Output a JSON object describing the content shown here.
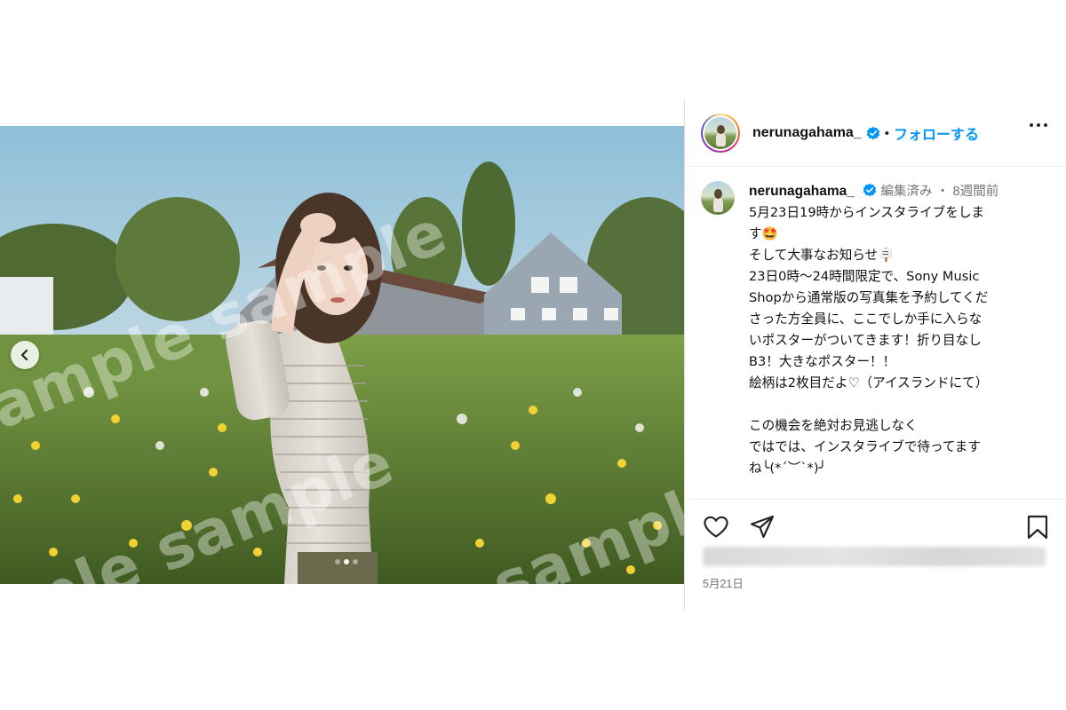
{
  "post": {
    "watermark_text": "sample sample",
    "carousel": {
      "total_slides": 3,
      "active_slide": 2
    }
  },
  "header": {
    "username": "nerunagahama_",
    "separator": "•",
    "follow_label": "フォローする"
  },
  "comment": {
    "username": "nerunagahama_",
    "edited_label": "編集済み",
    "separator": "・",
    "time_ago": "8週間前",
    "caption": "5月23日19時からインスタライブをしま\nす🤩\nそして大事なお知らせ🪧\n23日0時〜24時間限定で、Sony Music\nShopから通常版の写真集を予約してくだ\nさった方全員に、ここでしか手に入らな\nいポスターがついてきます！折り目なし\nB3！大きなポスター！！\n絵柄は2枚目だよ♡（アイスランドにて）\n\nこの機会を絶対お見逃しなく\nではでは、インスタライブで待ってます\nね╰(*´︶`*)╯"
  },
  "footer": {
    "post_date": "5月21日"
  },
  "icons": [
    "chevron-left-icon",
    "verified-badge-icon",
    "more-options-icon",
    "heart-icon",
    "share-icon",
    "bookmark-icon"
  ],
  "colors": {
    "follow_blue": "#0095f6",
    "verified_blue": "#0095f6",
    "meta_gray": "#737373"
  }
}
